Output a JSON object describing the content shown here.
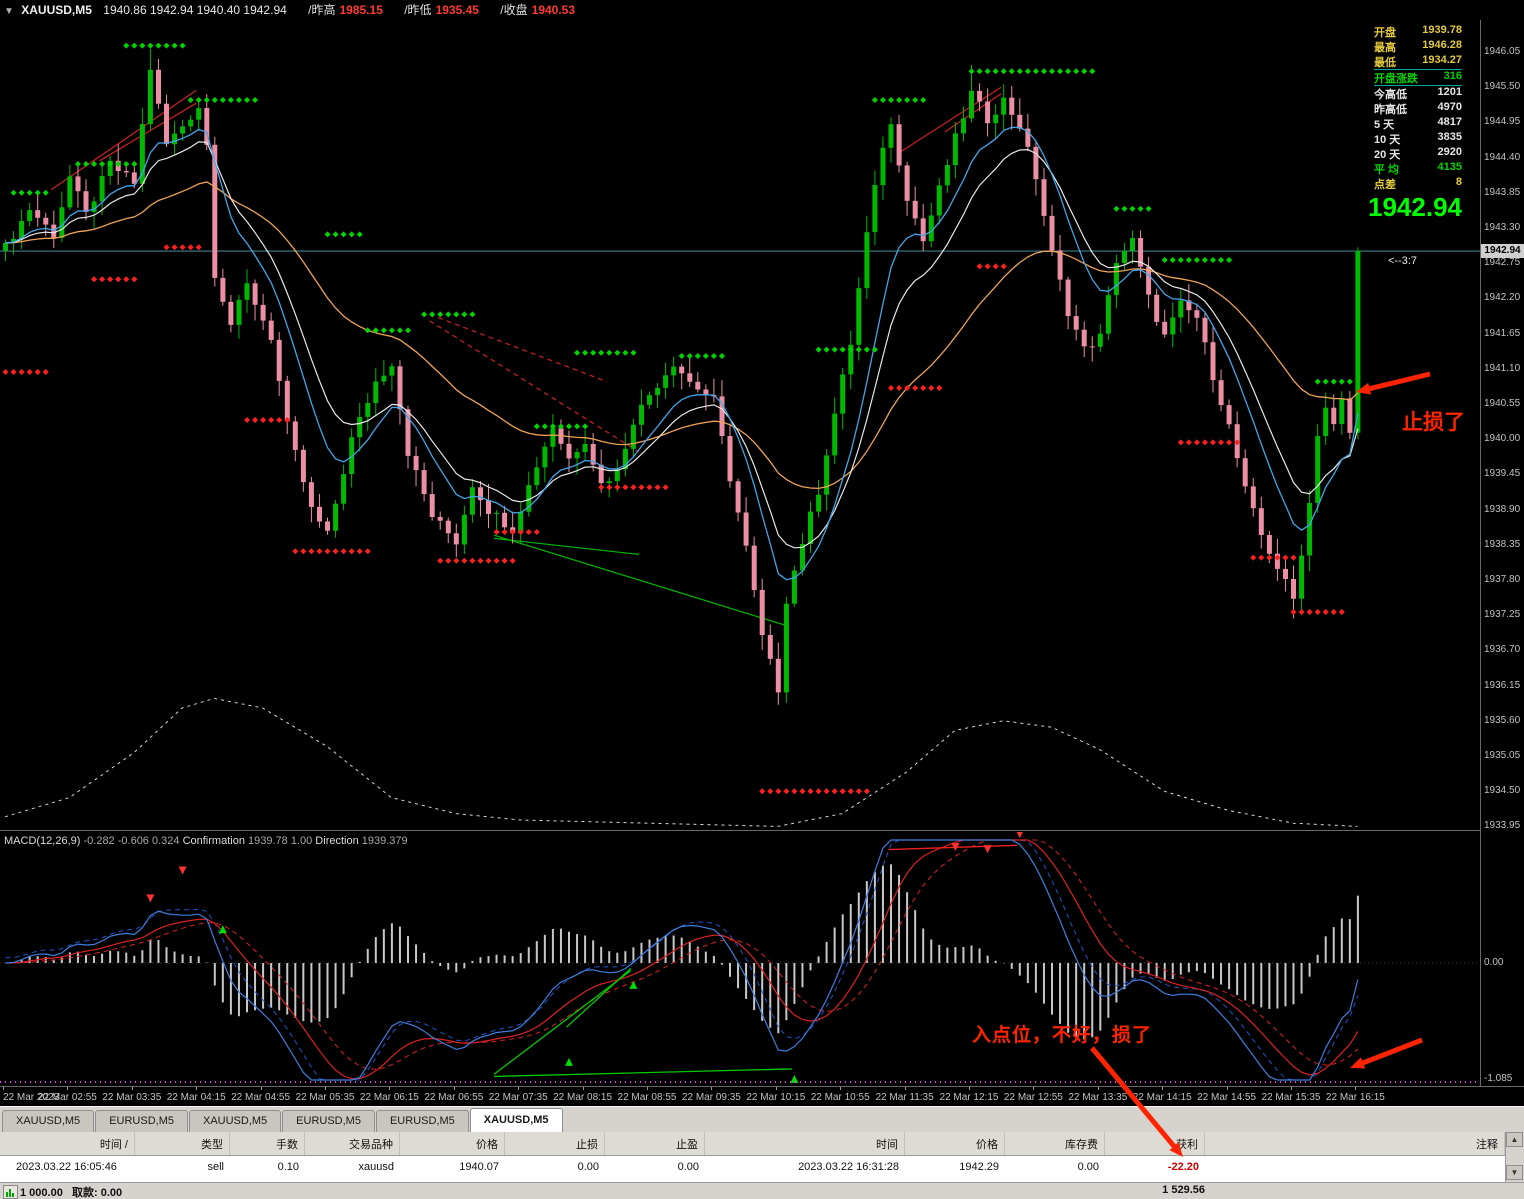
{
  "title_bar": {
    "symbol": "XAUUSD,M5",
    "quote": "1940.86 1942.94 1940.40 1942.94",
    "stats": [
      {
        "label": "/昨高",
        "value": "1985.15"
      },
      {
        "label": "/昨低",
        "value": "1935.45"
      },
      {
        "label": "/收盘",
        "value": "1940.53"
      }
    ]
  },
  "info_panel": {
    "rows": [
      {
        "label": "开盘",
        "value": "1939.78",
        "cls": "yellow"
      },
      {
        "label": "最高",
        "value": "1946.28",
        "cls": "yellow"
      },
      {
        "label": "最低",
        "value": "1934.27",
        "cls": "yellow"
      },
      {
        "label": "开盘涨跌",
        "value": "316",
        "cls": "green boxed"
      },
      {
        "label": "今高低",
        "value": "1201",
        "cls": "white"
      },
      {
        "label": "昨高低",
        "value": "4970",
        "cls": "white"
      },
      {
        "label": "5 天",
        "value": "4817",
        "cls": "white"
      },
      {
        "label": "10 天",
        "value": "3835",
        "cls": "white"
      },
      {
        "label": "20 天",
        "value": "2920",
        "cls": "white"
      },
      {
        "label": "平 均",
        "value": "4135",
        "cls": "green"
      },
      {
        "label": "点差",
        "value": "8",
        "cls": "yellow"
      }
    ],
    "big_price": "1942.94"
  },
  "annotations": {
    "stop_loss": "止损了",
    "entry_note": "入点位，不好，损了",
    "ratio": "<--3:7"
  },
  "chart_data": {
    "type": "candlestick",
    "symbol": "XAUUSD",
    "timeframe": "M5",
    "bars": 169,
    "current_price": 1942.94,
    "current_price_label": "1942.94",
    "price_axis_labels": [
      "1946.05",
      "1945.50",
      "1944.95",
      "1944.40",
      "1943.85",
      "1943.30",
      "1942.75",
      "1942.20",
      "1941.65",
      "1941.10",
      "1940.55",
      "1940.00",
      "1939.45",
      "1938.90",
      "1938.35",
      "1937.80",
      "1937.25",
      "1936.70",
      "1936.15",
      "1935.60",
      "1935.05",
      "1934.50",
      "1933.95"
    ],
    "time_labels": [
      "22 Mar 2023",
      "22 Mar 02:55",
      "22 Mar 03:35",
      "22 Mar 04:15",
      "22 Mar 04:55",
      "22 Mar 05:35",
      "22 Mar 06:15",
      "22 Mar 06:55",
      "22 Mar 07:35",
      "22 Mar 08:15",
      "22 Mar 08:55",
      "22 Mar 09:35",
      "22 Mar 10:15",
      "22 Mar 10:55",
      "22 Mar 11:35",
      "22 Mar 12:15",
      "22 Mar 12:55",
      "22 Mar 13:35",
      "22 Mar 14:15",
      "22 Mar 14:55",
      "22 Mar 15:35",
      "22 Mar 16:15"
    ],
    "price_path": [
      [
        0,
        1943.0
      ],
      [
        3,
        1943.6
      ],
      [
        6,
        1943.2
      ],
      [
        8,
        1944.1
      ],
      [
        10,
        1943.5
      ],
      [
        13,
        1944.3
      ],
      [
        16,
        1944.0
      ],
      [
        18,
        1945.8
      ],
      [
        20,
        1944.6
      ],
      [
        22,
        1944.9
      ],
      [
        24,
        1945.2
      ],
      [
        25,
        1944.6
      ],
      [
        26,
        1942.6
      ],
      [
        28,
        1941.8
      ],
      [
        30,
        1942.4
      ],
      [
        33,
        1941.6
      ],
      [
        35,
        1940.2
      ],
      [
        38,
        1938.9
      ],
      [
        40,
        1938.5
      ],
      [
        43,
        1940.0
      ],
      [
        46,
        1940.9
      ],
      [
        48,
        1941.2
      ],
      [
        50,
        1939.8
      ],
      [
        53,
        1938.8
      ],
      [
        56,
        1938.4
      ],
      [
        58,
        1939.3
      ],
      [
        60,
        1938.9
      ],
      [
        63,
        1938.6
      ],
      [
        66,
        1939.6
      ],
      [
        68,
        1940.2
      ],
      [
        70,
        1939.7
      ],
      [
        72,
        1940.0
      ],
      [
        74,
        1939.3
      ],
      [
        76,
        1939.5
      ],
      [
        78,
        1940.3
      ],
      [
        80,
        1940.7
      ],
      [
        83,
        1941.2
      ],
      [
        85,
        1940.9
      ],
      [
        88,
        1940.6
      ],
      [
        90,
        1939.4
      ],
      [
        92,
        1938.3
      ],
      [
        94,
        1936.9
      ],
      [
        96,
        1936.1
      ],
      [
        97,
        1937.5
      ],
      [
        99,
        1938.4
      ],
      [
        101,
        1939.2
      ],
      [
        103,
        1940.4
      ],
      [
        105,
        1941.5
      ],
      [
        107,
        1943.2
      ],
      [
        109,
        1944.6
      ],
      [
        110,
        1944.9
      ],
      [
        112,
        1943.8
      ],
      [
        114,
        1943.1
      ],
      [
        116,
        1943.9
      ],
      [
        118,
        1944.7
      ],
      [
        120,
        1945.4
      ],
      [
        122,
        1945.0
      ],
      [
        124,
        1945.3
      ],
      [
        126,
        1944.9
      ],
      [
        128,
        1944.1
      ],
      [
        130,
        1942.9
      ],
      [
        132,
        1942.0
      ],
      [
        134,
        1941.4
      ],
      [
        136,
        1941.6
      ],
      [
        138,
        1942.8
      ],
      [
        140,
        1943.1
      ],
      [
        142,
        1942.2
      ],
      [
        144,
        1941.6
      ],
      [
        146,
        1942.1
      ],
      [
        148,
        1941.9
      ],
      [
        150,
        1941.0
      ],
      [
        152,
        1940.2
      ],
      [
        154,
        1939.2
      ],
      [
        156,
        1938.5
      ],
      [
        158,
        1938.0
      ],
      [
        160,
        1937.5
      ],
      [
        162,
        1939.0
      ],
      [
        163,
        1940.1
      ],
      [
        164,
        1940.5
      ],
      [
        165,
        1940.2
      ],
      [
        166,
        1940.6
      ],
      [
        167,
        1940.1
      ],
      [
        168,
        1942.94
      ]
    ],
    "wick_overrides": [
      {
        "bar": 18,
        "high": 1946.1
      },
      {
        "bar": 96,
        "low": 1935.85
      },
      {
        "bar": 120,
        "high": 1945.85
      },
      {
        "bar": 160,
        "low": 1937.2
      },
      {
        "bar": 168,
        "high": 1943.0,
        "low": 1940.0
      }
    ],
    "signal_dots": [
      {
        "bar": 0,
        "count": 6,
        "price": 1941.05,
        "color": "red"
      },
      {
        "bar": 1,
        "count": 5,
        "price": 1943.85,
        "color": "green"
      },
      {
        "bar": 9,
        "count": 8,
        "price": 1944.3,
        "color": "green"
      },
      {
        "bar": 11,
        "count": 6,
        "price": 1942.5,
        "color": "red"
      },
      {
        "bar": 15,
        "count": 8,
        "price": 1946.15,
        "color": "green"
      },
      {
        "bar": 20,
        "count": 5,
        "price": 1943.0,
        "color": "red"
      },
      {
        "bar": 23,
        "count": 9,
        "price": 1945.3,
        "color": "green"
      },
      {
        "bar": 30,
        "count": 6,
        "price": 1940.3,
        "color": "red"
      },
      {
        "bar": 36,
        "count": 10,
        "price": 1938.25,
        "color": "red"
      },
      {
        "bar": 40,
        "count": 5,
        "price": 1943.2,
        "color": "green"
      },
      {
        "bar": 45,
        "count": 6,
        "price": 1941.7,
        "color": "green"
      },
      {
        "bar": 52,
        "count": 7,
        "price": 1941.95,
        "color": "green"
      },
      {
        "bar": 54,
        "count": 10,
        "price": 1938.1,
        "color": "red"
      },
      {
        "bar": 61,
        "count": 6,
        "price": 1938.55,
        "color": "red"
      },
      {
        "bar": 66,
        "count": 7,
        "price": 1940.2,
        "color": "green"
      },
      {
        "bar": 71,
        "count": 8,
        "price": 1941.35,
        "color": "green"
      },
      {
        "bar": 74,
        "count": 9,
        "price": 1939.25,
        "color": "red"
      },
      {
        "bar": 84,
        "count": 6,
        "price": 1941.3,
        "color": "green"
      },
      {
        "bar": 94,
        "count": 14,
        "price": 1934.5,
        "color": "red"
      },
      {
        "bar": 101,
        "count": 8,
        "price": 1941.4,
        "color": "green"
      },
      {
        "bar": 108,
        "count": 7,
        "price": 1945.3,
        "color": "green"
      },
      {
        "bar": 110,
        "count": 7,
        "price": 1940.8,
        "color": "red"
      },
      {
        "bar": 120,
        "count": 16,
        "price": 1945.75,
        "color": "green"
      },
      {
        "bar": 121,
        "count": 4,
        "price": 1942.7,
        "color": "red"
      },
      {
        "bar": 138,
        "count": 5,
        "price": 1943.6,
        "color": "green"
      },
      {
        "bar": 144,
        "count": 9,
        "price": 1942.8,
        "color": "green"
      },
      {
        "bar": 146,
        "count": 8,
        "price": 1939.95,
        "color": "red"
      },
      {
        "bar": 155,
        "count": 6,
        "price": 1938.15,
        "color": "red"
      },
      {
        "bar": 160,
        "count": 7,
        "price": 1937.3,
        "color": "red"
      },
      {
        "bar": 163,
        "count": 5,
        "price": 1940.9,
        "color": "green"
      }
    ],
    "trend_lines": [
      {
        "from": [
          6,
          1943.9
        ],
        "to": [
          24,
          1945.45
        ],
        "color": "red",
        "dash": false
      },
      {
        "from": [
          12,
          1944.35
        ],
        "to": [
          24,
          1945.25
        ],
        "color": "red",
        "dash": false
      },
      {
        "from": [
          53,
          1941.95
        ],
        "to": [
          75,
          1940.9
        ],
        "color": "red",
        "dash": true
      },
      {
        "from": [
          53,
          1941.85
        ],
        "to": [
          79,
          1939.8
        ],
        "color": "red",
        "dash": true
      },
      {
        "from": [
          61,
          1938.5
        ],
        "to": [
          97,
          1937.1
        ],
        "color": "green",
        "dash": false
      },
      {
        "from": [
          61,
          1938.45
        ],
        "to": [
          79,
          1938.2
        ],
        "color": "green",
        "dash": false
      },
      {
        "from": [
          111,
          1944.45
        ],
        "to": [
          124,
          1945.5
        ],
        "color": "red",
        "dash": false
      },
      {
        "from": [
          117,
          1944.8
        ],
        "to": [
          124,
          1945.4
        ],
        "color": "red",
        "dash": false
      }
    ],
    "overlay_curve": [
      [
        0,
        1934.1
      ],
      [
        8,
        1934.4
      ],
      [
        16,
        1935.1
      ],
      [
        22,
        1935.8
      ],
      [
        26,
        1935.95
      ],
      [
        32,
        1935.8
      ],
      [
        40,
        1935.2
      ],
      [
        48,
        1934.4
      ],
      [
        56,
        1934.15
      ],
      [
        64,
        1934.05
      ],
      [
        80,
        1934.0
      ],
      [
        96,
        1933.95
      ],
      [
        104,
        1934.15
      ],
      [
        112,
        1934.8
      ],
      [
        118,
        1935.45
      ],
      [
        124,
        1935.6
      ],
      [
        130,
        1935.5
      ],
      [
        136,
        1935.15
      ],
      [
        144,
        1934.5
      ],
      [
        152,
        1934.2
      ],
      [
        160,
        1934.0
      ],
      [
        168,
        1933.95
      ]
    ]
  },
  "macd_data": {
    "header_parts": [
      {
        "text": "MACD(12,26,9) ",
        "cls": "name"
      },
      {
        "text": "-0.282 ",
        "cls": "val"
      },
      {
        "text": "-0.606 ",
        "cls": "val"
      },
      {
        "text": "0.324",
        "cls": "val"
      },
      {
        "text": "   Confirmation ",
        "cls": "name"
      },
      {
        "text": "1939.78 ",
        "cls": "val"
      },
      {
        "text": "1.00",
        "cls": "val"
      },
      {
        "text": "   Direction ",
        "cls": "name"
      },
      {
        "text": "1939.379",
        "cls": "val"
      }
    ],
    "axis_labels": {
      "zero": "0.00",
      "min": "-1.085"
    },
    "green_segments": [
      [
        [
          61,
          -1.06
        ],
        [
          98,
          -0.99
        ]
      ],
      [
        [
          61,
          -1.04
        ],
        [
          78,
          -0.07
        ]
      ],
      [
        [
          70,
          -0.6
        ],
        [
          78,
          -0.05
        ]
      ]
    ],
    "red_segments": [
      [
        [
          110,
          1.06
        ],
        [
          126,
          1.1
        ]
      ]
    ],
    "up_arrows": [
      [
        27,
        0.4
      ],
      [
        70,
        -0.84
      ],
      [
        78,
        -0.12
      ],
      [
        98,
        -1.0
      ]
    ],
    "down_arrows": [
      [
        18,
        0.52
      ],
      [
        22,
        0.78
      ],
      [
        118,
        1.0
      ],
      [
        122,
        0.98
      ],
      [
        126,
        1.12
      ]
    ]
  },
  "tabs": {
    "items": [
      "XAUUSD,M5",
      "EURUSD,M5",
      "XAUUSD,M5",
      "EURUSD,M5",
      "EURUSD,M5",
      "XAUUSD,M5"
    ],
    "active_index": 5
  },
  "terminal": {
    "headers": [
      "时间 /",
      "类型",
      "手数",
      "交易品种",
      "价格",
      "止损",
      "止盈",
      "时间",
      "价格",
      "库存费",
      "获利",
      "注释"
    ],
    "rows": [
      [
        "2023.03.22 16:05:46",
        "sell",
        "0.10",
        "xauusd",
        "1940.07",
        "0.00",
        "0.00",
        "2023.03.22 16:31:28",
        "1942.29",
        "0.00",
        "-22.20",
        ""
      ]
    ]
  },
  "status_bar": {
    "balance": "1 000.00",
    "withdraw_label": "取款:",
    "withdraw_value": "0.00",
    "equity": "1 529.56"
  },
  "colors": {
    "up_candle": "#00b800",
    "down_candle": "#ec8fa4",
    "ma_fast_blue": "#42a5e8",
    "ma_mid_white": "#e8e8e8",
    "ma_slow_orange": "#efa356",
    "dot_red": "#ff2020",
    "dot_green": "#00d400",
    "annotation_red": "#ff2400",
    "loss_red": "#d00000",
    "big_price_green": "#00ff00",
    "info_yellow": "#e3c93e"
  }
}
